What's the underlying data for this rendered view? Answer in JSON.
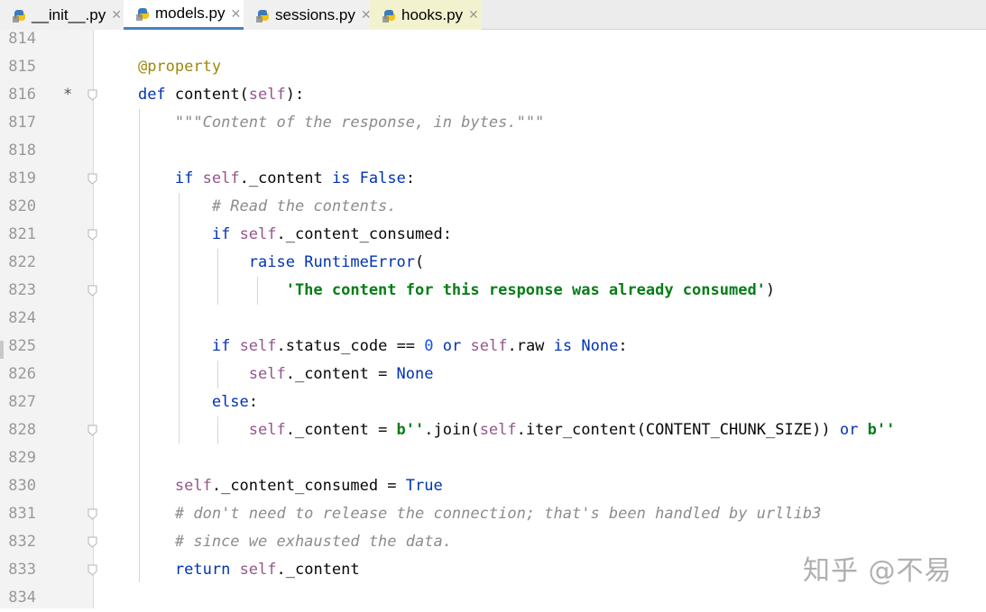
{
  "tabs": [
    {
      "label": "__init__.py",
      "active": false
    },
    {
      "label": "models.py",
      "active": true
    },
    {
      "label": "sessions.py",
      "active": false
    },
    {
      "label": "hooks.py",
      "active": false
    }
  ],
  "colors": {
    "keyword": "#0033b3",
    "self": "#94558d",
    "decorator": "#9e880d",
    "string": "#067d17",
    "comment": "#8c8c8c",
    "number": "#1750eb",
    "active_tab_underline": "#4083c9"
  },
  "lines": [
    {
      "n": "814",
      "tokens": []
    },
    {
      "n": "815",
      "tokens": [
        {
          "t": "    "
        },
        {
          "t": "@property",
          "c": "dec"
        }
      ]
    },
    {
      "n": "816",
      "mark": "*",
      "fold": true,
      "tokens": [
        {
          "t": "    "
        },
        {
          "t": "def",
          "c": "kw"
        },
        {
          "t": " content("
        },
        {
          "t": "self",
          "c": "self"
        },
        {
          "t": "):"
        }
      ]
    },
    {
      "n": "817",
      "tokens": [
        {
          "t": "        "
        },
        {
          "t": "\"\"\"Content of the response, in bytes.\"\"\"",
          "c": "doc"
        }
      ]
    },
    {
      "n": "818",
      "tokens": []
    },
    {
      "n": "819",
      "fold": true,
      "tokens": [
        {
          "t": "        "
        },
        {
          "t": "if",
          "c": "kw"
        },
        {
          "t": " "
        },
        {
          "t": "self",
          "c": "self"
        },
        {
          "t": "._content "
        },
        {
          "t": "is",
          "c": "kw"
        },
        {
          "t": " "
        },
        {
          "t": "False",
          "c": "kw"
        },
        {
          "t": ":"
        }
      ]
    },
    {
      "n": "820",
      "tokens": [
        {
          "t": "            "
        },
        {
          "t": "# Read the contents.",
          "c": "cmt"
        }
      ]
    },
    {
      "n": "821",
      "fold": true,
      "tokens": [
        {
          "t": "            "
        },
        {
          "t": "if",
          "c": "kw"
        },
        {
          "t": " "
        },
        {
          "t": "self",
          "c": "self"
        },
        {
          "t": "._content_consumed:"
        }
      ]
    },
    {
      "n": "822",
      "tokens": [
        {
          "t": "                "
        },
        {
          "t": "raise",
          "c": "kw"
        },
        {
          "t": " "
        },
        {
          "t": "RuntimeError",
          "c": "kw"
        },
        {
          "t": "("
        }
      ]
    },
    {
      "n": "823",
      "fold": true,
      "tokens": [
        {
          "t": "                    "
        },
        {
          "t": "'The content for this response was already consumed'",
          "c": "str"
        },
        {
          "t": ")"
        }
      ]
    },
    {
      "n": "824",
      "tokens": []
    },
    {
      "n": "825",
      "tokens": [
        {
          "t": "            "
        },
        {
          "t": "if",
          "c": "kw"
        },
        {
          "t": " "
        },
        {
          "t": "self",
          "c": "self"
        },
        {
          "t": ".status_code == "
        },
        {
          "t": "0",
          "c": "num"
        },
        {
          "t": " "
        },
        {
          "t": "or",
          "c": "kw"
        },
        {
          "t": " "
        },
        {
          "t": "self",
          "c": "self"
        },
        {
          "t": ".raw "
        },
        {
          "t": "is",
          "c": "kw"
        },
        {
          "t": " "
        },
        {
          "t": "None",
          "c": "kw"
        },
        {
          "t": ":"
        }
      ]
    },
    {
      "n": "826",
      "tokens": [
        {
          "t": "                "
        },
        {
          "t": "self",
          "c": "self"
        },
        {
          "t": "._content = "
        },
        {
          "t": "None",
          "c": "kw"
        }
      ]
    },
    {
      "n": "827",
      "tokens": [
        {
          "t": "            "
        },
        {
          "t": "else",
          "c": "kw"
        },
        {
          "t": ":"
        }
      ]
    },
    {
      "n": "828",
      "fold": true,
      "tokens": [
        {
          "t": "                "
        },
        {
          "t": "self",
          "c": "self"
        },
        {
          "t": "._content = "
        },
        {
          "t": "b''",
          "c": "str"
        },
        {
          "t": ".join("
        },
        {
          "t": "self",
          "c": "self"
        },
        {
          "t": ".iter_content(CONTENT_CHUNK_SIZE)) "
        },
        {
          "t": "or",
          "c": "kw"
        },
        {
          "t": " "
        },
        {
          "t": "b''",
          "c": "str"
        }
      ]
    },
    {
      "n": "829",
      "tokens": []
    },
    {
      "n": "830",
      "tokens": [
        {
          "t": "        "
        },
        {
          "t": "self",
          "c": "self"
        },
        {
          "t": "._content_consumed = "
        },
        {
          "t": "True",
          "c": "kw"
        }
      ]
    },
    {
      "n": "831",
      "fold": true,
      "tokens": [
        {
          "t": "        "
        },
        {
          "t": "# don't need to release the connection; that's been handled by urllib3",
          "c": "cmt"
        }
      ]
    },
    {
      "n": "832",
      "fold": true,
      "tokens": [
        {
          "t": "        "
        },
        {
          "t": "# since we exhausted the data.",
          "c": "cmt"
        }
      ]
    },
    {
      "n": "833",
      "fold": true,
      "tokens": [
        {
          "t": "        "
        },
        {
          "t": "return",
          "c": "kw"
        },
        {
          "t": " "
        },
        {
          "t": "self",
          "c": "self"
        },
        {
          "t": "._content"
        }
      ]
    },
    {
      "n": "834",
      "tokens": []
    }
  ],
  "watermark": "知乎 @不易"
}
